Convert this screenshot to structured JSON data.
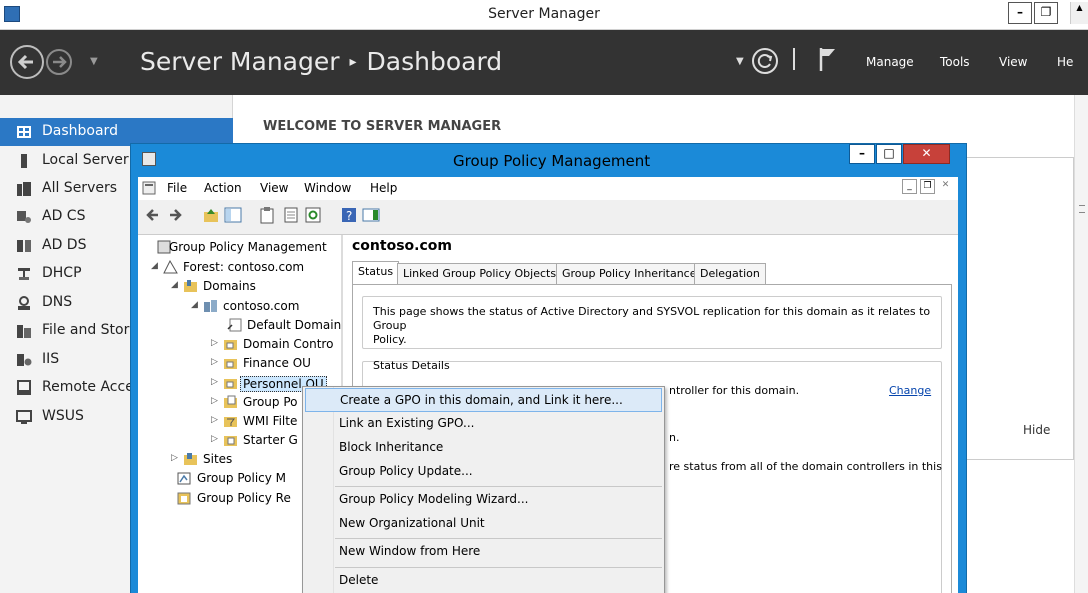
{
  "server_manager": {
    "title": "Server Manager",
    "breadcrumb": {
      "app": "Server Manager",
      "separator": "▸",
      "page": "Dashboard"
    },
    "menu": [
      "Manage",
      "Tools",
      "View",
      "He"
    ],
    "nav_items": [
      {
        "label": "Dashboard",
        "icon": "dashboard-icon",
        "active": true
      },
      {
        "label": "Local Server",
        "icon": "local-server-icon"
      },
      {
        "label": "All Servers",
        "icon": "all-servers-icon"
      },
      {
        "label": "AD CS",
        "icon": "ad-cs-icon"
      },
      {
        "label": "AD DS",
        "icon": "ad-ds-icon"
      },
      {
        "label": "DHCP",
        "icon": "dhcp-icon"
      },
      {
        "label": "DNS",
        "icon": "dns-icon"
      },
      {
        "label": "File and Stora",
        "icon": "file-storage-icon"
      },
      {
        "label": "IIS",
        "icon": "iis-icon"
      },
      {
        "label": "Remote Acce",
        "icon": "remote-access-icon"
      },
      {
        "label": "WSUS",
        "icon": "wsus-icon"
      }
    ],
    "welcome": "WELCOME TO SERVER MANAGER",
    "hide_label": "Hide"
  },
  "gpm": {
    "title": "Group Policy Management",
    "menu": [
      "File",
      "Action",
      "View",
      "Window",
      "Help"
    ],
    "tree": [
      {
        "label": "Group Policy Management",
        "icon": "gpm-root-icon",
        "twisty": ""
      },
      {
        "label": "Forest: contoso.com",
        "icon": "forest-icon",
        "twisty": "◢"
      },
      {
        "label": "Domains",
        "icon": "domains-icon",
        "twisty": "◢"
      },
      {
        "label": "contoso.com",
        "icon": "domain-icon",
        "twisty": "◢"
      },
      {
        "label": "Default Domain",
        "icon": "gpo-link-icon",
        "twisty": ""
      },
      {
        "label": "Domain Contro",
        "icon": "ou-icon",
        "twisty": "▷"
      },
      {
        "label": "Finance OU",
        "icon": "ou-icon",
        "twisty": "▷"
      },
      {
        "label": "Personnel OU",
        "icon": "ou-icon",
        "twisty": "▷"
      },
      {
        "label": "Group Po",
        "icon": "gpo-folder-icon",
        "twisty": "▷"
      },
      {
        "label": "WMI Filte",
        "icon": "wmi-folder-icon",
        "twisty": "▷"
      },
      {
        "label": "Starter G",
        "icon": "starter-gpo-icon",
        "twisty": "▷"
      },
      {
        "label": "Sites",
        "icon": "sites-icon",
        "twisty": "▷"
      },
      {
        "label": "Group Policy M",
        "icon": "modeling-icon",
        "twisty": ""
      },
      {
        "label": "Group Policy Re",
        "icon": "results-icon",
        "twisty": ""
      }
    ],
    "details": {
      "title": "contoso.com",
      "tabs": [
        "Status",
        "Linked Group Policy Objects",
        "Group Policy Inheritance",
        "Delegation"
      ],
      "info_line1": "This page shows the status of Active Directory and SYSVOL replication for this domain as it relates to Group",
      "info_line2": "Policy.",
      "status_heading": "Status Details",
      "line_a": "ntroller for this domain.",
      "change": "Change",
      "line_b": "n.",
      "line_c": "re status from all of the domain controllers in this"
    }
  },
  "context_menu": [
    {
      "label": "Create a GPO in this domain, and Link it here...",
      "highlight": true
    },
    {
      "label": "Link an Existing GPO..."
    },
    {
      "label": "Block Inheritance"
    },
    {
      "label": "Group Policy Update...",
      "sep_after": true
    },
    {
      "label": "Group Policy Modeling Wizard..."
    },
    {
      "label": "New Organizational Unit",
      "sep_after": true
    },
    {
      "label": "New Window from Here",
      "sep_after": true
    },
    {
      "label": "Delete"
    }
  ]
}
